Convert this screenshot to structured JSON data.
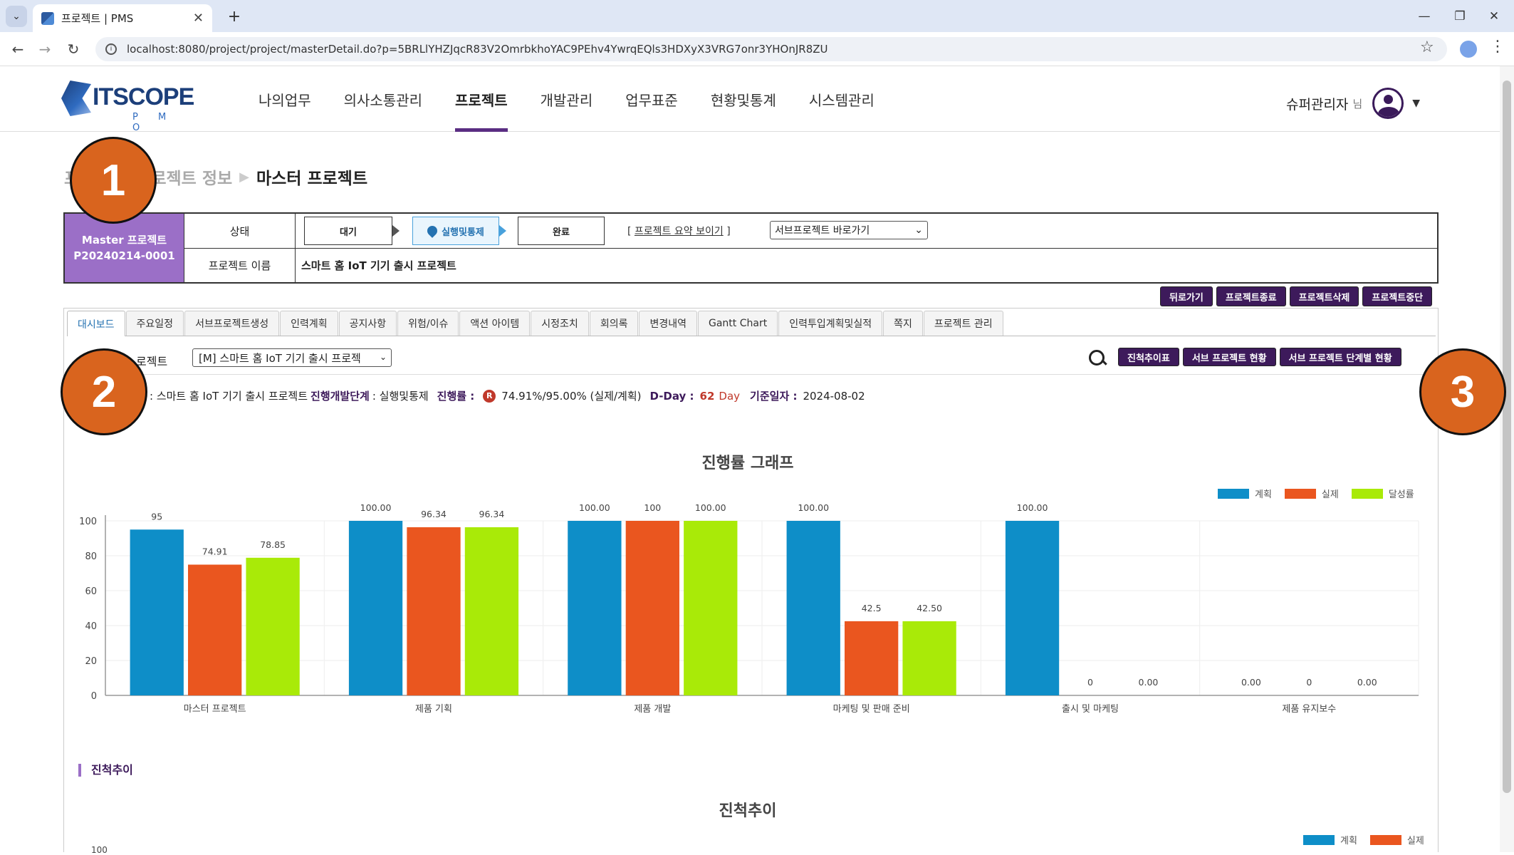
{
  "browser": {
    "tab_title": "프로젝트 | PMS",
    "url": "localhost:8080/project/project/masterDetail.do?p=5BRLlYHZJqcR83V2OmrbkhoYAC9PEhv4YwrqEQls3HDXyX3VRG7onr3YHOnJR8ZU"
  },
  "logo": {
    "name": "ITSCOPE",
    "sub": "P M O"
  },
  "nav": {
    "items": [
      "나의업무",
      "의사소통관리",
      "프로젝트",
      "개발관리",
      "업무표준",
      "현황및통계",
      "시스템관리"
    ],
    "active": "프로젝트"
  },
  "user": {
    "name": "슈퍼관리자",
    "suffix": "님"
  },
  "breadcrumb": {
    "item1": "프",
    "item2": "프로젝트 정보",
    "current": "마스터 프로젝트"
  },
  "project": {
    "master_label": "Master 프로젝트",
    "code": "P20240214-0001",
    "state_label": "상태",
    "steps": [
      "대기",
      "실행및통제",
      "완료"
    ],
    "active_step": "실행및통제",
    "summary_link": "프로젝트 요약 보이기",
    "sub_select": "서브프로젝트 바로가기",
    "name_label": "프로젝트 이름",
    "name": "스마트 홈 IoT 기기 출시 프로젝트"
  },
  "actions": [
    "뒤로가기",
    "프로젝트종료",
    "프로젝트삭제",
    "프로젝트중단"
  ],
  "tabs": [
    "대시보드",
    "주요일정",
    "서브프로젝트생성",
    "인력계획",
    "공지사항",
    "위험/이슈",
    "액션 아이템",
    "시정조치",
    "회의록",
    "변경내역",
    "Gantt Chart",
    "인력투입계획및실적",
    "쪽지",
    "프로젝트 관리"
  ],
  "active_tab": "대시보드",
  "filter": {
    "label": "로젝트",
    "select": "[M] 스마트 홈 IoT 기기 출시 프로젝",
    "buttons": [
      "진척추이표",
      "서브 프로젝트 현황",
      "서브 프로젝트 단계별 현황"
    ]
  },
  "info": {
    "project": ": 스마트 홈 IoT 기기 출시 프로젝트",
    "stage_label": "진행개발단계",
    "stage_value": ": 실행및통제",
    "progress_label": "진행률 :",
    "progress_badge": "R",
    "progress_value": "74.91%/95.00% (실제/계획)",
    "dday_label": "D-Day :",
    "dday_value": "62",
    "dday_unit": "Day",
    "date_label": "기준일자 :",
    "date_value": "2024-08-02"
  },
  "annotations": [
    "1",
    "2",
    "3"
  ],
  "colors": {
    "plan": "#0e8ec8",
    "actual": "#ea561f",
    "rate": "#a9ea08",
    "brand": "#3d1a5b"
  },
  "chart_data": [
    {
      "type": "bar",
      "title": "진행률 그래프",
      "categories": [
        "마스터 프로젝트",
        "제품 기획",
        "제품 개발",
        "마케팅 및 판매 준비",
        "출시 및 마케팅",
        "제품 유지보수"
      ],
      "series": [
        {
          "name": "계획",
          "values": [
            95,
            100,
            100,
            100,
            100,
            0
          ],
          "labels": [
            "95",
            "100.00",
            "100.00",
            "100.00",
            "100.00",
            "0.00"
          ]
        },
        {
          "name": "실제",
          "values": [
            74.91,
            96.34,
            100,
            42.5,
            0,
            0
          ],
          "labels": [
            "74.91",
            "96.34",
            "100",
            "42.5",
            "0",
            "0"
          ]
        },
        {
          "name": "달성률",
          "values": [
            78.85,
            96.34,
            100,
            42.5,
            0,
            0
          ],
          "labels": [
            "78.85",
            "96.34",
            "100.00",
            "42.50",
            "0.00",
            "0.00"
          ]
        }
      ],
      "ylim": [
        0,
        100
      ],
      "yticks": [
        0,
        20,
        40,
        60,
        80,
        100
      ],
      "grid": true,
      "legend": "top-right"
    },
    {
      "type": "line",
      "title": "진척추이",
      "series": [
        {
          "name": "계획"
        },
        {
          "name": "실제"
        }
      ],
      "yticks_visible": [
        "100"
      ],
      "legend": "top-right"
    }
  ],
  "section_trend": "진척추이"
}
